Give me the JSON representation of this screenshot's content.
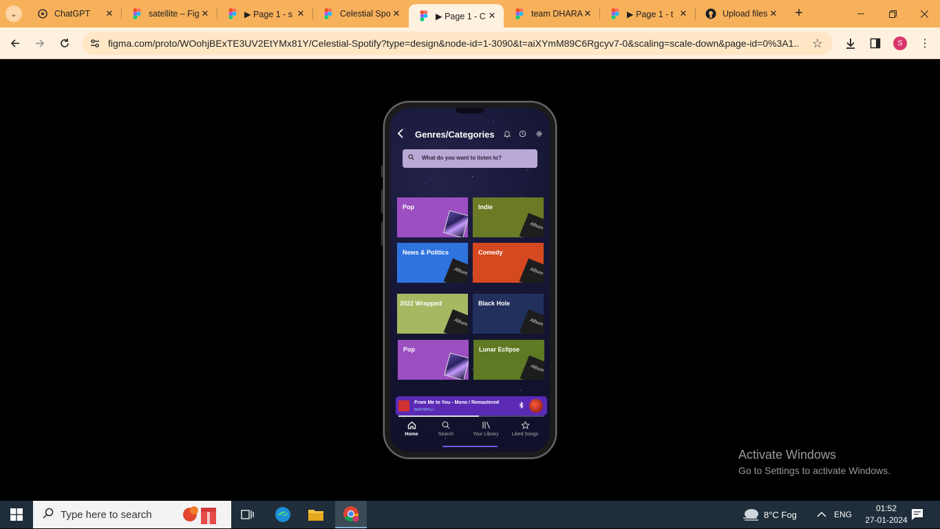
{
  "browser": {
    "tabs": [
      {
        "title": "ChatGPT",
        "icon": "chatgpt-icon",
        "active": false
      },
      {
        "title": "satellite – Fig",
        "icon": "figma-icon",
        "active": false
      },
      {
        "title": "▶ Page 1 - s",
        "icon": "figma-icon",
        "active": false
      },
      {
        "title": "Celestial Spo",
        "icon": "figma-icon",
        "active": false
      },
      {
        "title": "▶ Page 1 - C",
        "icon": "figma-icon",
        "active": true
      },
      {
        "title": "team DHARA",
        "icon": "figma-icon",
        "active": false
      },
      {
        "title": "▶ Page 1 - t",
        "icon": "figma-icon",
        "active": false
      },
      {
        "title": "Upload files",
        "icon": "github-icon",
        "active": false
      }
    ],
    "url": "figma.com/proto/WOohjBExTE3UV2EtYMx81Y/Celestial-Spotify?type=design&node-id=1-3090&t=aiXYmM89C6Rgcyv7-0&scaling=scale-down&page-id=0%3A1...",
    "profile_initial": "S",
    "accent": "#f8b15b"
  },
  "app": {
    "title": "Genres/Categories",
    "search_placeholder": "What do you want to listen to?",
    "cards": [
      {
        "label": "Pop",
        "color": "#9b4fc0",
        "art": "cover"
      },
      {
        "label": "Indie",
        "color": "#6b7a25",
        "art": "album"
      },
      {
        "label": "News & Politics",
        "color": "#2f73df",
        "art": "album"
      },
      {
        "label": "Comedy",
        "color": "#d4491f",
        "art": "album"
      },
      {
        "label": "2022 Wrapped",
        "color": "#a5b862",
        "art": "album"
      },
      {
        "label": "Black Hole",
        "color": "#22305e",
        "art": "album"
      },
      {
        "label": "Pop",
        "color": "#9b4fc0",
        "art": "cover"
      },
      {
        "label": "Lunar Eclipse",
        "color": "#5f7a22",
        "art": "album"
      }
    ],
    "album_text": "Album",
    "now_playing": {
      "song": "From Me to You - Mono / Remastered",
      "device": "BEATSPILL+",
      "progress": 0.55
    },
    "nav": [
      {
        "label": "Home",
        "icon": "home-icon",
        "active": true
      },
      {
        "label": "Search",
        "icon": "search-icon",
        "active": false
      },
      {
        "label": "Your Library",
        "icon": "library-icon",
        "active": false
      },
      {
        "label": "Liked Songs",
        "icon": "star-icon",
        "active": false
      }
    ]
  },
  "watermark": {
    "line1": "Activate Windows",
    "line2": "Go to Settings to activate Windows."
  },
  "taskbar": {
    "search_placeholder": "Type here to search",
    "weather": "8°C  Fog",
    "language": "ENG",
    "time": "01:52",
    "date": "27-01-2024"
  }
}
